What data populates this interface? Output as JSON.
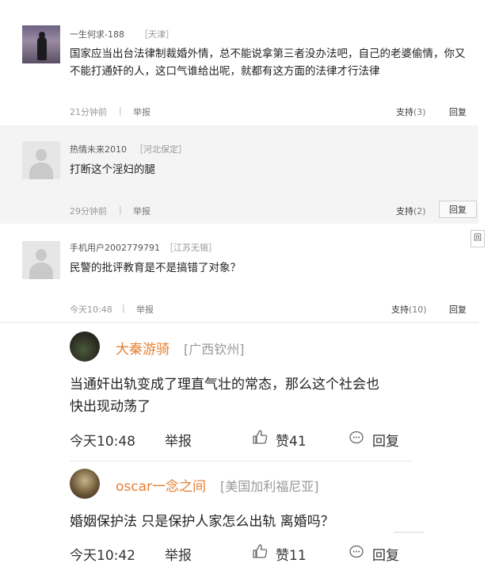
{
  "comments": [
    {
      "username": "一生何求-188",
      "location": "［天津］",
      "text_lines": [
        "国家应当出台法律制裁婚外情，总不能说拿第三者没办法吧，自己的老婆偷情，你又",
        "不能打通奸的人，这口气谁给出呢，就都有这方面的法律才行法律"
      ],
      "time": "21分钟前",
      "report": "举报",
      "support_label": "支持",
      "support_count": "(3)",
      "reply": "回复"
    },
    {
      "username": "热情未来2010",
      "location": "［河北保定］",
      "text_lines": [
        "打断这个淫妇的腿"
      ],
      "time": "29分钟前",
      "report": "举报",
      "support_label": "支持",
      "support_count": "(2)",
      "reply": "回复"
    },
    {
      "username": "手机用户2002779791",
      "location": "［江苏无锡］",
      "text_lines": [
        "民警的批评教育是不是搞错了对象？"
      ],
      "time": "今天10:48",
      "report": "举报",
      "support_label": "支持",
      "support_count": "(10)",
      "reply": "回复"
    }
  ],
  "edge_tab": "回",
  "mobile_comments": [
    {
      "username": "大秦游骑",
      "location": "[广西钦州]",
      "text_lines": [
        "当通奸出轨变成了理直气壮的常态，那么这个社会也",
        "快出现动荡了"
      ],
      "time": "今天10:48",
      "report": "举报",
      "like_label": "赞41",
      "reply": "回复"
    },
    {
      "username": "oscar一念之间",
      "location": "[美国加利福尼亚]",
      "text_lines": [
        "婚姻保护法  只是保护人家怎么出轨 离婚吗？"
      ],
      "time": "今天10:42",
      "report": "举报",
      "like_label": "赞11",
      "reply": "回复"
    }
  ],
  "icons": {
    "like": "thumbs-up-icon",
    "reply": "speech-bubble-icon"
  },
  "colors": {
    "username_orange": "#e87f30",
    "grey_background": "#f4f4f4"
  }
}
